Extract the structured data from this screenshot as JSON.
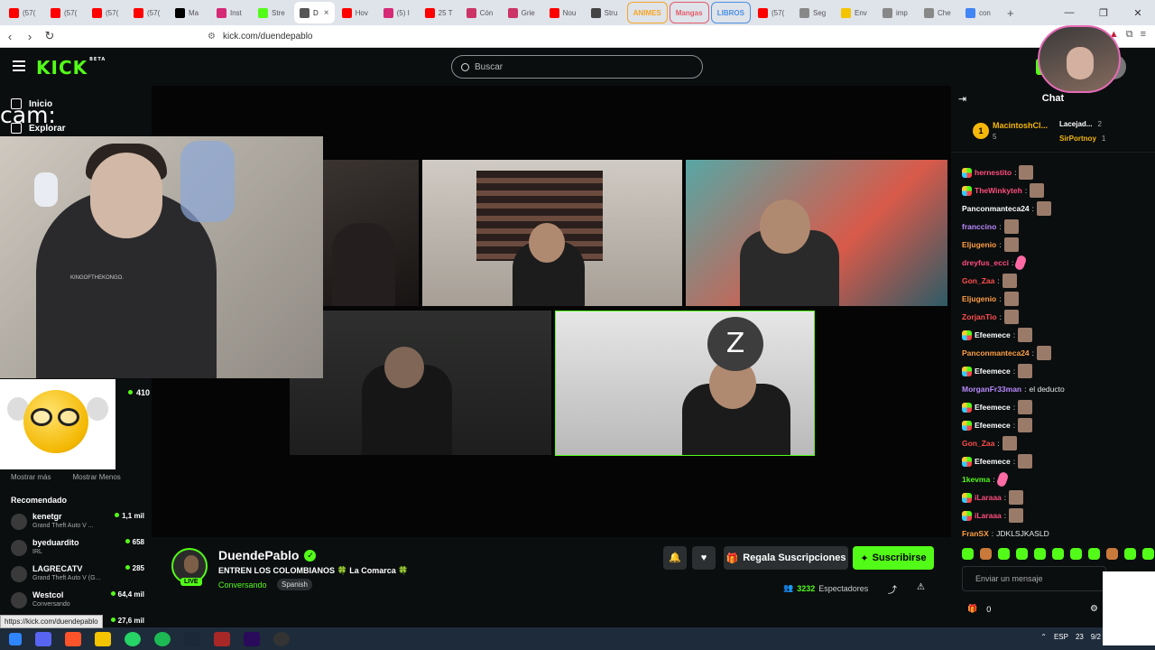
{
  "browser": {
    "tabs": [
      {
        "label": "(57(",
        "color": "#ff0000"
      },
      {
        "label": "(57(",
        "color": "#ff0000"
      },
      {
        "label": "(57(",
        "color": "#ff0000"
      },
      {
        "label": "(57(",
        "color": "#ff0000"
      },
      {
        "label": "Ma",
        "color": "#000000"
      },
      {
        "label": "Inst",
        "color": "#d62976"
      },
      {
        "label": "Stre",
        "color": "#53fc18"
      },
      {
        "label": "D",
        "color": "#555555",
        "active": true
      },
      {
        "label": "Hov",
        "color": "#ff0000"
      },
      {
        "label": "(5) I",
        "color": "#d62976"
      },
      {
        "label": "25 T",
        "color": "#ff0000"
      },
      {
        "label": "Cón",
        "color": "#cc3366"
      },
      {
        "label": "Grie",
        "color": "#cc3366"
      },
      {
        "label": "Nou",
        "color": "#ff0000"
      },
      {
        "label": "Stru",
        "color": "#444444"
      }
    ],
    "groups": [
      {
        "label": "ANIMES",
        "color": "#f5a623"
      },
      {
        "label": "Mangas",
        "color": "#e35b6a"
      },
      {
        "label": "LIBROS",
        "color": "#4a90e2"
      }
    ],
    "tabs_after": [
      {
        "label": "(57(",
        "color": "#ff0000"
      },
      {
        "label": "Seg",
        "color": "#888888"
      },
      {
        "label": "Env",
        "color": "#f5c400"
      },
      {
        "label": "imp",
        "color": "#888888"
      },
      {
        "label": "Che",
        "color": "#888888"
      },
      {
        "label": "con",
        "color": "#4285f4"
      }
    ],
    "url": "kick.com/duendepablo"
  },
  "header": {
    "logo": "KICK",
    "logo_tag": "BETA",
    "search_placeholder": "Buscar"
  },
  "sidebar": {
    "inicio": "Inicio",
    "explorar": "Explorar",
    "cam_label": "cam:",
    "followed_count": "410",
    "show_more": "Mostrar más",
    "show_less": "Mostrar Menos",
    "recommended_title": "Recomendado",
    "recommended": [
      {
        "name": "kenetgr",
        "game": "Grand Theft Auto V ...",
        "viewers": "1,1 mil"
      },
      {
        "name": "byeduardito",
        "game": "IRL",
        "viewers": "658"
      },
      {
        "name": "LAGRECATV",
        "game": "Grand Theft Auto V (G...",
        "viewers": "285"
      },
      {
        "name": "Westcol",
        "game": "Conversando",
        "viewers": "64,4 mil"
      },
      {
        "name": "",
        "game": "",
        "viewers": "27,6 mil"
      }
    ],
    "cam_shirt_text": "KINGOFTHEKONGO."
  },
  "stream": {
    "name": "DuendePablo",
    "title": "ENTREN LOS COLOMBIANOS 🍀 La Comarca 🍀",
    "category": "Conversando",
    "language": "Spanish",
    "live": "LIVE",
    "gift_label": "Regala Suscripciones",
    "subscribe_label": "Suscribirse",
    "viewers": "3232",
    "viewers_label": "Espectadores"
  },
  "chat": {
    "title": "Chat",
    "leaderboard": [
      {
        "rank": "1",
        "name": "MacintoshCl...",
        "count": "5"
      },
      {
        "name": "Lacejad...",
        "count": "2"
      },
      {
        "name": "SirPortnoy",
        "count": "1"
      }
    ],
    "messages": [
      {
        "user": "hernestito",
        "color": "#ff4d7d",
        "badge": true,
        "text": "",
        "emote": "face"
      },
      {
        "user": "TheWinkyteh",
        "color": "#ff4d7d",
        "badge": true,
        "text": "",
        "emote": "face"
      },
      {
        "user": "Panconmanteca24",
        "color": "#ffffff",
        "badge": false,
        "text": "",
        "emote": "face"
      },
      {
        "user": "franccino",
        "color": "#b98aff",
        "badge": false,
        "text": "",
        "emote": "face"
      },
      {
        "user": "Eljugenio",
        "color": "#ff9f43",
        "badge": false,
        "text": "",
        "emote": "face"
      },
      {
        "user": "dreyfus_ecci",
        "color": "#ff4d7d",
        "badge": false,
        "text": "",
        "emote": "pink"
      },
      {
        "user": "Gon_Zaa",
        "color": "#ff4d4d",
        "badge": false,
        "text": "",
        "emote": "face"
      },
      {
        "user": "Eljugenio",
        "color": "#ff9f43",
        "badge": false,
        "text": "",
        "emote": "face"
      },
      {
        "user": "ZorjanTio",
        "color": "#ff4d4d",
        "badge": false,
        "text": "",
        "emote": "face"
      },
      {
        "user": "Efeemece",
        "color": "#ffffff",
        "badge": true,
        "text": "",
        "emote": "face"
      },
      {
        "user": "Panconmanteca24",
        "color": "#ff9f43",
        "badge": false,
        "text": "",
        "emote": "face"
      },
      {
        "user": "Efeemece",
        "color": "#ffffff",
        "badge": true,
        "text": "",
        "emote": "face"
      },
      {
        "user": "MorganFr33man",
        "color": "#b98aff",
        "badge": false,
        "text": "el deducto",
        "emote": ""
      },
      {
        "user": "Efeemece",
        "color": "#ffffff",
        "badge": true,
        "text": "",
        "emote": "face"
      },
      {
        "user": "Efeemece",
        "color": "#ffffff",
        "badge": true,
        "text": "",
        "emote": "face"
      },
      {
        "user": "Gon_Zaa",
        "color": "#ff4d4d",
        "badge": false,
        "text": "",
        "emote": "face"
      },
      {
        "user": "Efeemece",
        "color": "#ffffff",
        "badge": true,
        "text": "",
        "emote": "face"
      },
      {
        "user": "1kevma",
        "color": "#53fc18",
        "badge": false,
        "text": "",
        "emote": "pink"
      },
      {
        "user": "iLaraaa",
        "color": "#ff4d7d",
        "badge": true,
        "text": "",
        "emote": "face"
      },
      {
        "user": "iLaraaa",
        "color": "#ff4d7d",
        "badge": true,
        "text": "",
        "emote": "face"
      },
      {
        "user": "FranSX",
        "color": "#ff9f43",
        "badge": false,
        "text": "JDKLSJKASLD",
        "emote": ""
      }
    ],
    "input_placeholder": "Enviar un mensaje",
    "points": "0"
  },
  "status_url": "https://kick.com/duendepablo",
  "tray": {
    "lang": "ESP",
    "time": "23",
    "date": "9/2"
  },
  "colors": {
    "accent": "#53fc18",
    "bg": "#0b0e0f",
    "panel": "#2b2f31"
  }
}
